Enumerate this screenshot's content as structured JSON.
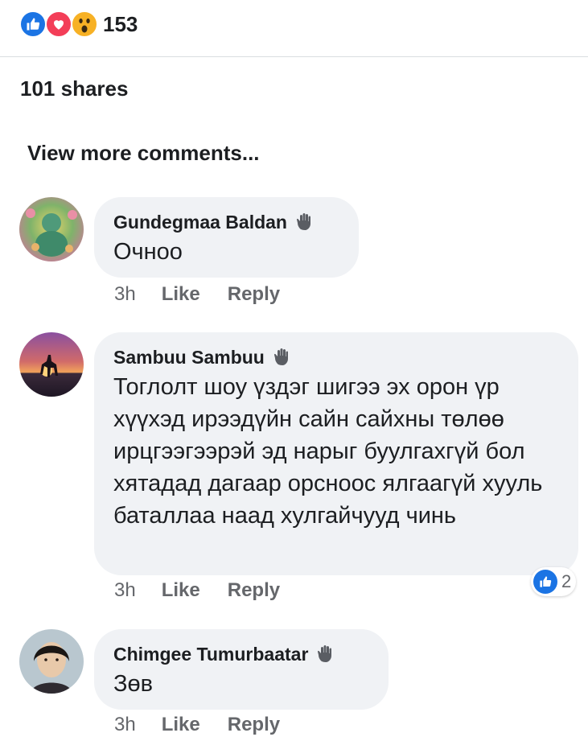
{
  "reactions": {
    "icons": [
      "like-icon",
      "love-icon",
      "wow-icon"
    ],
    "count": "153"
  },
  "shares": "101 shares",
  "view_more": "View more comments...",
  "comments": [
    {
      "author": "Gundegmaa Baldan",
      "text": "Очноо",
      "time": "3h",
      "like": "Like",
      "reply": "Reply"
    },
    {
      "author": "Sambuu Sambuu",
      "text": "Тоглолт шоу үздэг шигээ эх орон үр хүүхэд ирээдүйн сайн сайхны төлөө ирцгээгээрэй эд нарыг буулгахгүй бол хятадад дагаар орсноос ялгаагүй хууль баталлаа наад хулгайчууд чинь",
      "time": "3h",
      "like": "Like",
      "reply": "Reply",
      "reaction_count": "2"
    },
    {
      "author": "Chimgee Tumurbaatar",
      "text": "Зөв",
      "time": "3h",
      "like": "Like",
      "reply": "Reply"
    }
  ],
  "colors": {
    "like_blue": "#1b74e4",
    "love_red": "#f33e58",
    "wow_yellow": "#f7b125",
    "bubble_bg": "#f0f2f5",
    "meta_gray": "#65676b"
  }
}
